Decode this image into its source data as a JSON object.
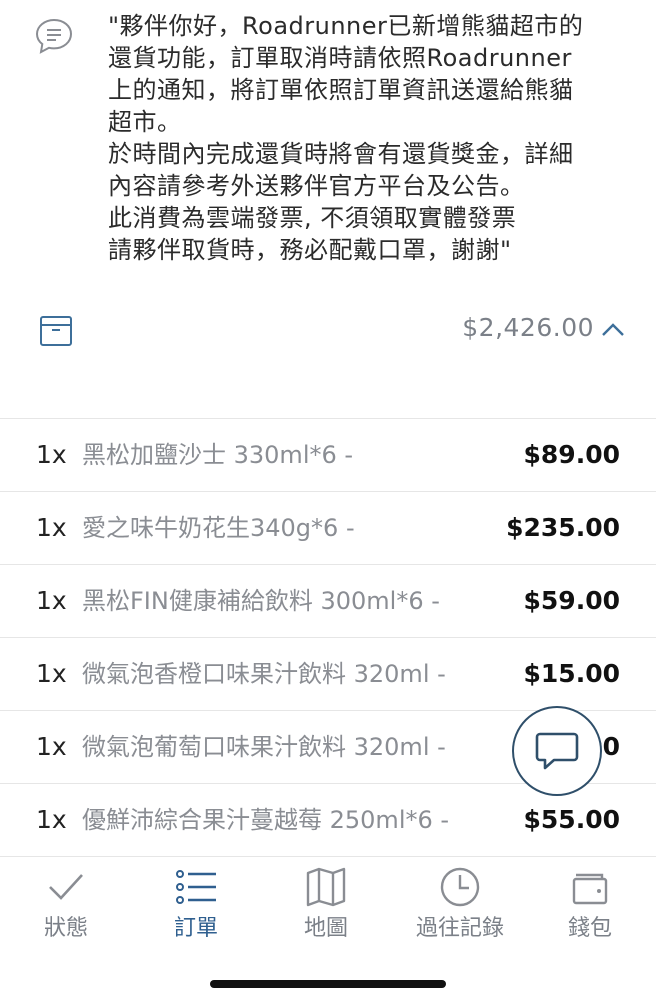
{
  "note": {
    "icon": "chat-bubble-icon",
    "lines": [
      "\"夥伴你好，Roadrunner已新增熊貓超市的",
      "還貨功能，訂單取消時請依照Roadrunner",
      "上的通知，將訂單依照訂單資訊送還給熊貓",
      "超市。",
      "於時間內完成還貨時將會有還貨獎金，詳細",
      "內容請參考外送夥伴官方平台及公告。",
      "此消費為雲端發票, 不須領取實體發票",
      "請夥伴取貨時，務必配戴口罩，謝謝\""
    ]
  },
  "order": {
    "total": "$2,426.00",
    "box_icon": "package-box-icon",
    "collapse_icon": "chevron-up-icon",
    "items": [
      {
        "qty": "1x",
        "name": "黑松加鹽沙士 330ml*6 -",
        "price": "$89.00"
      },
      {
        "qty": "1x",
        "name": "愛之味牛奶花生340g*6 -",
        "price": "$235.00"
      },
      {
        "qty": "1x",
        "name": "黑松FIN健康補給飲料 300ml*6 -",
        "price": "$59.00"
      },
      {
        "qty": "1x",
        "name": "微氣泡香橙口味果汁飲料 320ml -",
        "price": "$15.00"
      },
      {
        "qty": "1x",
        "name": "微氣泡葡萄口味果汁飲料 320ml -",
        "price": "$15.00"
      },
      {
        "qty": "1x",
        "name": "優鮮沛綜合果汁蔓越莓 250ml*6 -",
        "price": "$55.00"
      }
    ]
  },
  "chat_fab_icon": "chat-icon",
  "tabs": [
    {
      "label": "狀態",
      "icon": "checkmark-icon",
      "active": false
    },
    {
      "label": "訂單",
      "icon": "list-icon",
      "active": true
    },
    {
      "label": "地圖",
      "icon": "map-icon",
      "active": false
    },
    {
      "label": "過往記錄",
      "icon": "clock-icon",
      "active": false
    },
    {
      "label": "錢包",
      "icon": "wallet-icon",
      "active": false
    }
  ],
  "colors": {
    "accent": "#2f5f8f",
    "muted": "#7b8088",
    "divider": "#e6e6e6"
  }
}
